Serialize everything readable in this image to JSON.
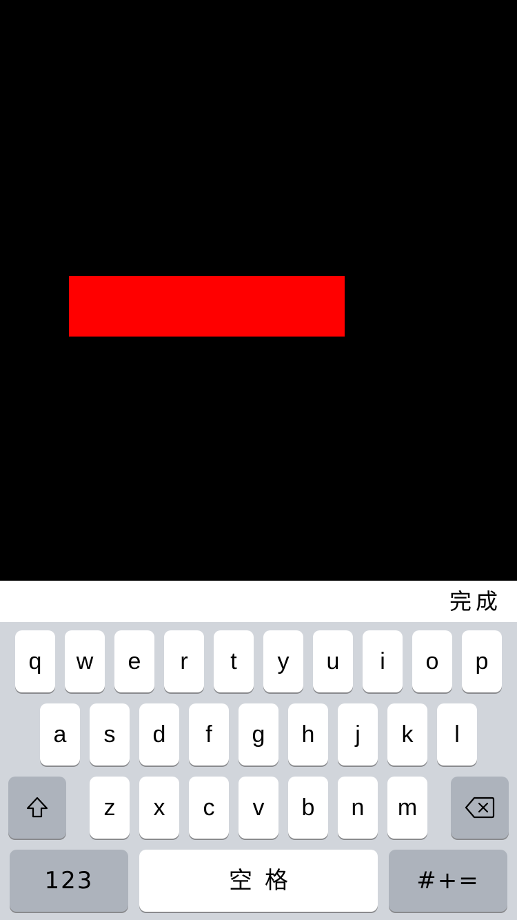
{
  "colors": {
    "background": "#000000",
    "red_bar": "#ff0000",
    "keyboard_bg": "#d1d5db",
    "key_light": "#ffffff",
    "key_dark": "#adb3bc"
  },
  "toolbar": {
    "done_label": "完成"
  },
  "keyboard": {
    "row1": [
      "q",
      "w",
      "e",
      "r",
      "t",
      "y",
      "u",
      "i",
      "o",
      "p"
    ],
    "row2": [
      "a",
      "s",
      "d",
      "f",
      "g",
      "h",
      "j",
      "k",
      "l"
    ],
    "row3": [
      "z",
      "x",
      "c",
      "v",
      "b",
      "n",
      "m"
    ],
    "shift_icon": "shift-arrow-icon",
    "delete_icon": "backspace-icon",
    "numbers_label": "123",
    "space_label": "空格",
    "symbols_label": "#+="
  }
}
